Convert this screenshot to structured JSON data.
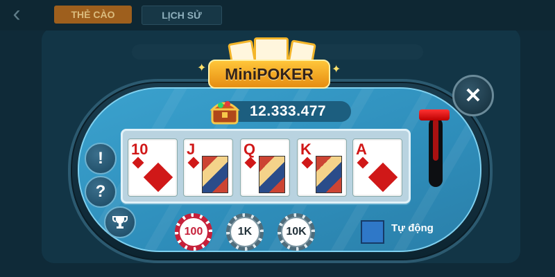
{
  "topbar": {
    "back_icon": "chevron-left-icon",
    "tabs": [
      {
        "label": "THẺ CÀO"
      },
      {
        "label": "LỊCH SỬ"
      }
    ]
  },
  "game": {
    "title": "MiniPOKER",
    "jackpot": "12.333.477",
    "close_icon": "close-icon",
    "side_buttons": [
      {
        "label": "!",
        "icon": "info-icon"
      },
      {
        "label": "?",
        "icon": "help-icon"
      },
      {
        "label": "",
        "icon": "trophy-icon"
      }
    ],
    "cards": [
      {
        "rank": "10",
        "suit": "diamond"
      },
      {
        "rank": "J",
        "suit": "diamond"
      },
      {
        "rank": "Q",
        "suit": "diamond"
      },
      {
        "rank": "K",
        "suit": "diamond"
      },
      {
        "rank": "A",
        "suit": "diamond"
      }
    ],
    "bets": [
      {
        "label": "100"
      },
      {
        "label": "1K"
      },
      {
        "label": "10K"
      }
    ],
    "auto_label": "Tự động"
  },
  "colors": {
    "table_blue": "#3ba2ce",
    "gold": "#ffc63a",
    "red": "#d01818"
  }
}
